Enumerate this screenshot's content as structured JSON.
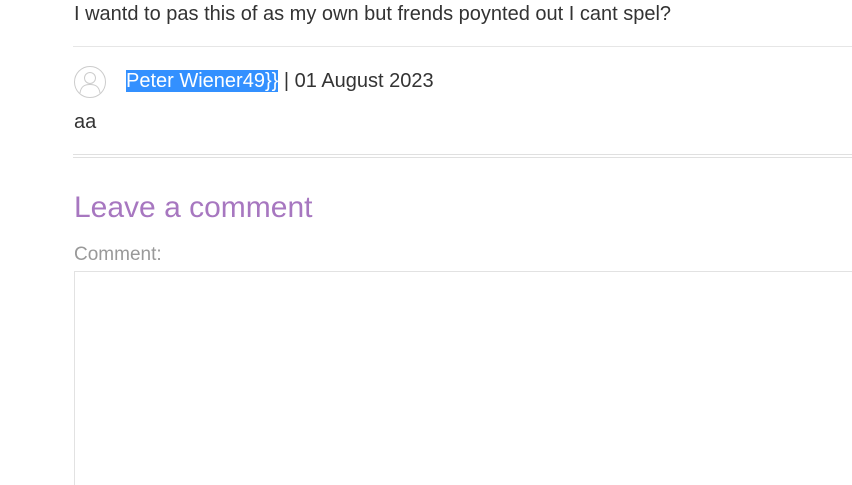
{
  "previous_comment": {
    "text": "I wantd to pas this of as my own but frends poynted out I cant spel?"
  },
  "comment": {
    "avatar_icon": "default-user-avatar-icon",
    "author": "Peter Wiener49}}",
    "separator": " | ",
    "date": "01 August 2023",
    "body": "aa"
  },
  "comment_form": {
    "heading": "Leave a comment",
    "comment_label": "Comment:",
    "comment_value": ""
  },
  "colors": {
    "heading": "#a777c0",
    "selection_highlight": "#3390ff",
    "label": "#999999"
  }
}
